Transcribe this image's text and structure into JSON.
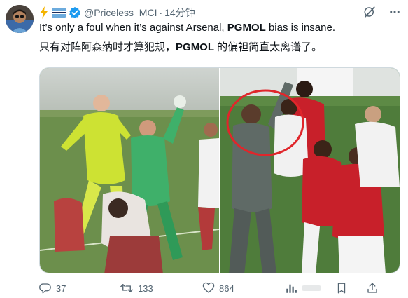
{
  "author": {
    "handle": "@Priceless_MCI",
    "time": "14分钟",
    "badge_emoji": "⚡",
    "verified_color": "#1d9bf0"
  },
  "post": {
    "text_en_prefix": "It’s only a foul when it’s against Arsenal, ",
    "text_en_bold": "PGMOL",
    "text_en_suffix": " bias is insane.",
    "text_zh_prefix": "只有对阵阿森纳时才算犯规，",
    "text_zh_bold": "PGMOL",
    "text_zh_suffix": " 的偏袒简直太离谱了。"
  },
  "metrics": {
    "replies": "37",
    "reposts": "133",
    "likes": "864"
  },
  "icons": {
    "reply": "reply-icon",
    "repost": "repost-icon",
    "like": "like-icon",
    "views": "views-icon",
    "bookmark": "bookmark-icon",
    "share": "share-icon",
    "grok": "grok-icon",
    "more": "more-icon"
  },
  "colors": {
    "text": "#0f1419",
    "muted": "#536471",
    "accent": "#1d9bf0",
    "highlight_circle": "#e0262b"
  }
}
